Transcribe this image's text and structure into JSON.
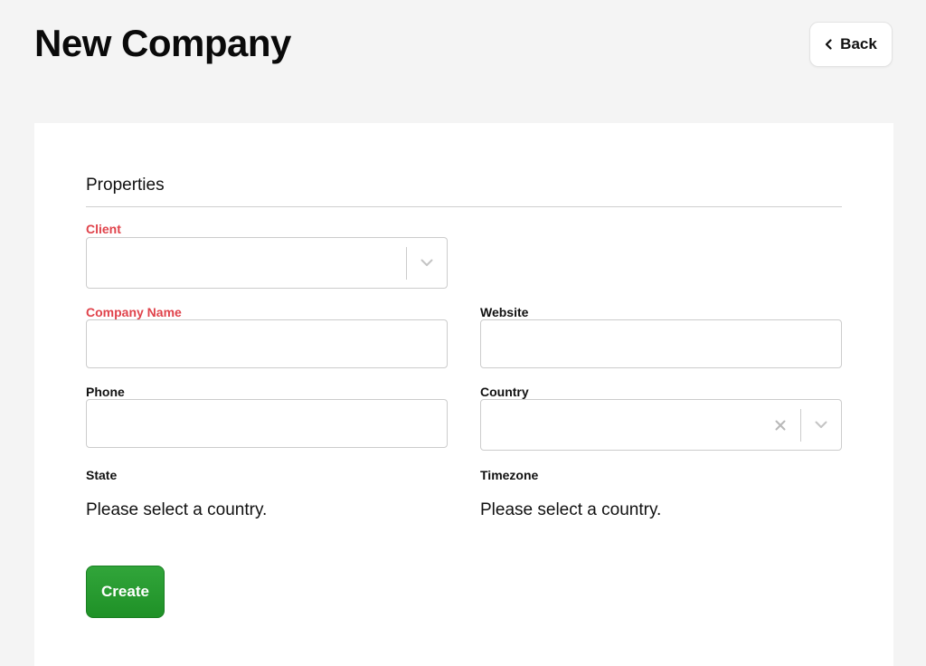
{
  "header": {
    "title": "New Company",
    "back_label": "Back"
  },
  "form": {
    "section_title": "Properties",
    "client": {
      "label": "Client",
      "value": ""
    },
    "company_name": {
      "label": "Company Name",
      "value": ""
    },
    "website": {
      "label": "Website",
      "value": ""
    },
    "phone": {
      "label": "Phone",
      "value": ""
    },
    "country": {
      "label": "Country",
      "value": ""
    },
    "state": {
      "label": "State",
      "message": "Please select a country."
    },
    "timezone": {
      "label": "Timezone",
      "message": "Please select a country."
    },
    "submit_label": "Create"
  },
  "colors": {
    "required_label": "#e0434b",
    "create_button": "#2a9d32",
    "background": "#f4f4f4"
  },
  "icons": {
    "back": "chevron-left-icon",
    "dropdown": "chevron-down-icon",
    "clear": "close-icon"
  }
}
